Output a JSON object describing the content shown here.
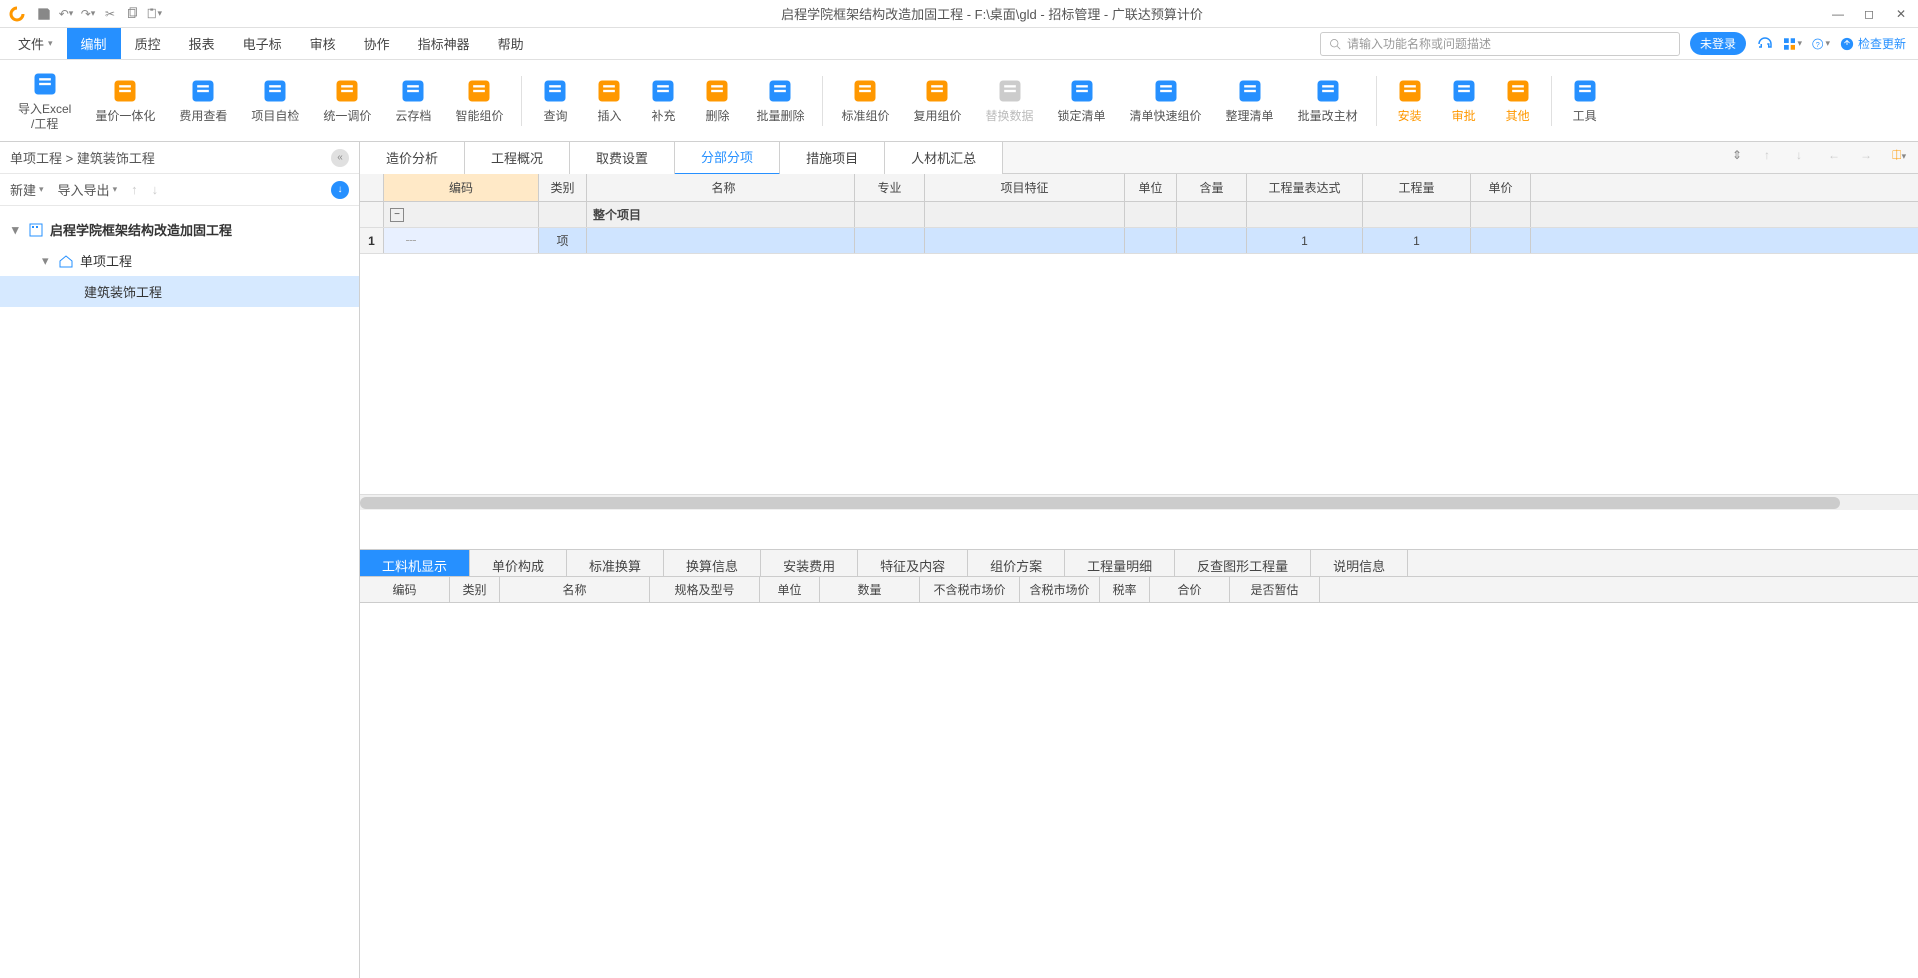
{
  "title": "启程学院框架结构改造加固工程 - F:\\桌面\\gld - 招标管理 - 广联达预算计价",
  "menus": {
    "file": "文件",
    "edit": "编制",
    "qc": "质控",
    "report": "报表",
    "ebid": "电子标",
    "review": "审核",
    "collab": "协作",
    "indicator": "指标神器",
    "help": "帮助"
  },
  "search_placeholder": "请输入功能名称或问题描述",
  "login_badge": "未登录",
  "check_update": "检查更新",
  "ribbon": [
    {
      "label": "导入Excel\n/工程",
      "key": "import-excel"
    },
    {
      "label": "量价一体化",
      "key": "qty-price"
    },
    {
      "label": "费用查看",
      "key": "fee-view"
    },
    {
      "label": "项目自检",
      "key": "self-check"
    },
    {
      "label": "统一调价",
      "key": "unified-adj"
    },
    {
      "label": "云存档",
      "key": "cloud-save"
    },
    {
      "label": "智能组价",
      "key": "smart-price",
      "sep": true
    },
    {
      "label": "查询",
      "key": "query"
    },
    {
      "label": "插入",
      "key": "insert"
    },
    {
      "label": "补充",
      "key": "supplement"
    },
    {
      "label": "删除",
      "key": "delete"
    },
    {
      "label": "批量删除",
      "key": "batch-delete",
      "sep": true
    },
    {
      "label": "标准组价",
      "key": "std-price"
    },
    {
      "label": "复用组价",
      "key": "reuse-price"
    },
    {
      "label": "替换数据",
      "key": "replace-data",
      "disabled": true
    },
    {
      "label": "锁定清单",
      "key": "lock-list"
    },
    {
      "label": "清单快速组价",
      "key": "quick-price"
    },
    {
      "label": "整理清单",
      "key": "tidy-list"
    },
    {
      "label": "批量改主材",
      "key": "batch-material",
      "sep": true
    },
    {
      "label": "安装",
      "key": "install",
      "orange": true
    },
    {
      "label": "审批",
      "key": "approve",
      "orange": true
    },
    {
      "label": "其他",
      "key": "other",
      "orange": true,
      "sep": true
    },
    {
      "label": "工具",
      "key": "tools"
    }
  ],
  "breadcrumb": "单项工程 > 建筑装饰工程",
  "lp_toolbar": {
    "new": "新建",
    "io": "导入导出"
  },
  "tree": {
    "root": "启程学院框架结构改造加固工程",
    "l1": "单项工程",
    "l2": "建筑装饰工程"
  },
  "top_tabs": [
    "造价分析",
    "工程概况",
    "取费设置",
    "分部分项",
    "措施项目",
    "人材机汇总"
  ],
  "top_tab_active": 3,
  "grid_columns": [
    "编码",
    "类别",
    "名称",
    "专业",
    "项目特征",
    "单位",
    "含量",
    "工程量表达式",
    "工程量",
    "单价"
  ],
  "grid": {
    "group_name": "整个项目",
    "row1": {
      "num": "1",
      "type": "项",
      "expr": "1",
      "qty": "1"
    }
  },
  "bottom_tabs": [
    "工料机显示",
    "单价构成",
    "标准换算",
    "换算信息",
    "安装费用",
    "特征及内容",
    "组价方案",
    "工程量明细",
    "反查图形工程量",
    "说明信息"
  ],
  "bottom_tab_active": 0,
  "bottom_columns": [
    "编码",
    "类别",
    "名称",
    "规格及型号",
    "单位",
    "数量",
    "不含税市场价",
    "含税市场价",
    "税率",
    "合价",
    "是否暂估"
  ]
}
